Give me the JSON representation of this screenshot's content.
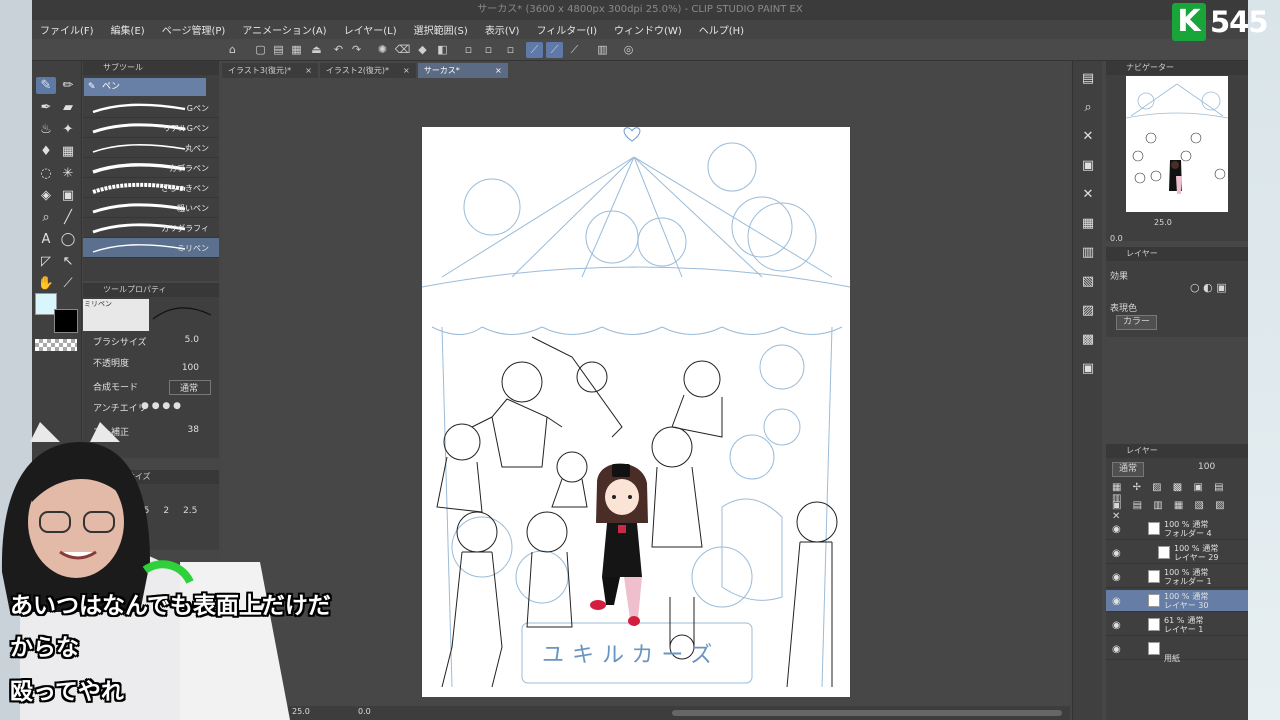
{
  "window": {
    "title": "サーカス* (3600 x 4800px 300dpi 25.0%) - CLIP STUDIO PAINT EX"
  },
  "menu": [
    "ファイル(F)",
    "編集(E)",
    "ページ管理(P)",
    "アニメーション(A)",
    "レイヤー(L)",
    "選択範囲(S)",
    "表示(V)",
    "フィルター(I)",
    "ウィンドウ(W)",
    "ヘルプ(H)"
  ],
  "tabs": [
    {
      "label": "イラスト3(復元)*",
      "close": "×"
    },
    {
      "label": "イラスト2(復元)*",
      "close": "×"
    },
    {
      "label": "サーカス*",
      "close": "×"
    }
  ],
  "subtool": {
    "title": "サブツール",
    "group": "ペン",
    "brushes": [
      {
        "name": "Gペン"
      },
      {
        "name": "リアルGペン"
      },
      {
        "name": "丸ペン"
      },
      {
        "name": "カブラペン"
      },
      {
        "name": "ざらつきペン"
      },
      {
        "name": "粗いペン"
      },
      {
        "name": "カリグラフィ"
      },
      {
        "name": "ミリペン"
      }
    ]
  },
  "toolprop": {
    "title": "ツールプロパティ",
    "brush_name": "ミリペン",
    "brush_size_label": "ブラシサイズ",
    "brush_size": "5.0",
    "opacity_label": "不透明度",
    "opacity": "100",
    "blend_label": "合成モード",
    "blend_value": "通常",
    "antialias_label": "アンチエイリ",
    "stabilize_label": "ブレ補正",
    "stabilize": "38"
  },
  "brushsize": {
    "title": "ブラシサイズ",
    "values": [
      "1.5",
      "2",
      "2.5"
    ]
  },
  "navigator": {
    "title": "ナビゲーター",
    "zoom": "25.0",
    "angle": "0.0"
  },
  "layer_property": {
    "title": "レイヤー",
    "effect_label": "効果",
    "color_label": "表現色",
    "color_value": "カラー"
  },
  "layers_panel": {
    "title": "レイヤー",
    "blend": "通常",
    "opacity": "100",
    "items": [
      {
        "percent": "100 %",
        "mode": "通常",
        "name": "フォルダー 4"
      },
      {
        "percent": "100 %",
        "mode": "通常",
        "name": "レイヤー 29"
      },
      {
        "percent": "100 %",
        "mode": "通常",
        "name": "フォルダー 1"
      },
      {
        "percent": "100 %",
        "mode": "通常",
        "name": "レイヤー 30"
      },
      {
        "percent": "61 %",
        "mode": "通常",
        "name": "レイヤー 1"
      },
      {
        "percent": "",
        "mode": "",
        "name": "用紙"
      }
    ]
  },
  "status": {
    "zoom": "25.0",
    "angle": "0.0"
  },
  "badge": {
    "letter": "K",
    "count": "545"
  },
  "captions": [
    "あいつはなんでも表面上だけだ",
    "からな",
    "殴ってやれ"
  ],
  "canvas": {
    "banner_text": "ユキルカーズ"
  },
  "colors": {
    "accent": "#6a82ad",
    "foreground": "#d8f6fb",
    "background": "#000000"
  }
}
